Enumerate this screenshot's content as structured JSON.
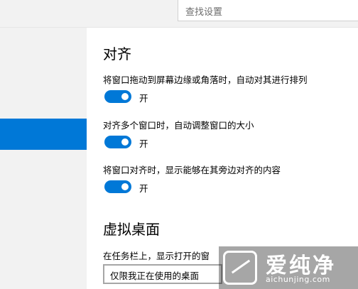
{
  "search": {
    "placeholder": "查找设置"
  },
  "snap": {
    "title": "对齐",
    "settings": [
      {
        "label": "将窗口拖动到屏幕边缘或角落时，自动对其进行排列",
        "state": "开"
      },
      {
        "label": "对齐多个窗口时，自动调整窗口的大小",
        "state": "开"
      },
      {
        "label": "将窗口对齐时，显示能够在其旁边对齐的内容",
        "state": "开"
      }
    ]
  },
  "virtual_desktop": {
    "title": "虚拟桌面",
    "taskbar_label": "在任务栏上，显示打开的窗",
    "dropdown_value": "仅限我正在使用的桌面"
  },
  "watermark": {
    "brand": "爱纯净",
    "url": "aichunjing.com"
  },
  "colors": {
    "accent": "#0078d7",
    "sidebar_bg": "#f2f2f2"
  }
}
